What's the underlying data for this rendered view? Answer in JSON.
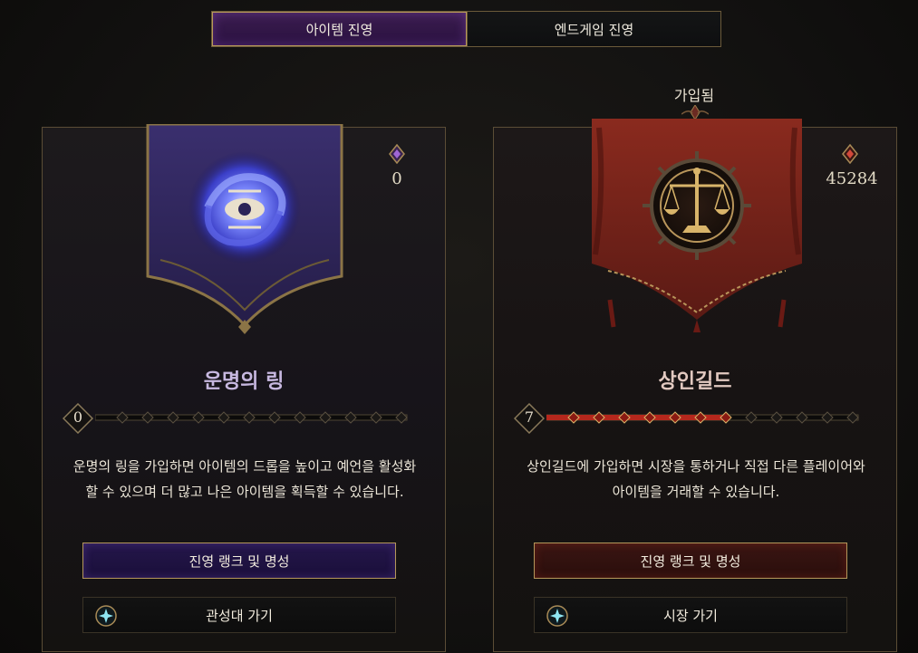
{
  "tabs": [
    {
      "label": "아이템 진영",
      "active": true
    },
    {
      "label": "엔드게임 진영",
      "active": false
    }
  ],
  "joined_label": "가입됨",
  "factions": [
    {
      "name": "운명의 링",
      "currency": "0",
      "rank": "0",
      "rank_progress": 0,
      "description": "운명의 링을 가입하면 아이템의 드롭을 높이고 예언을 활성화 할 수 있으며 더 많고 나은 아이템을 획득할 수 있습니다.",
      "rank_button": "진영 랭크 및 명성",
      "go_button": "관성대 가기",
      "accent": "#2a1140"
    },
    {
      "name": "상인길드",
      "currency": "45284",
      "rank": "7",
      "rank_progress": 0.58,
      "description": "상인길드에 가입하면 시장을 통하거나 직접 다른 플레이어와 아이템을 거래할 수 있습니다.",
      "rank_button": "진영 랭크 및 명성",
      "go_button": "시장 가기",
      "accent": "#8c1f16"
    }
  ]
}
